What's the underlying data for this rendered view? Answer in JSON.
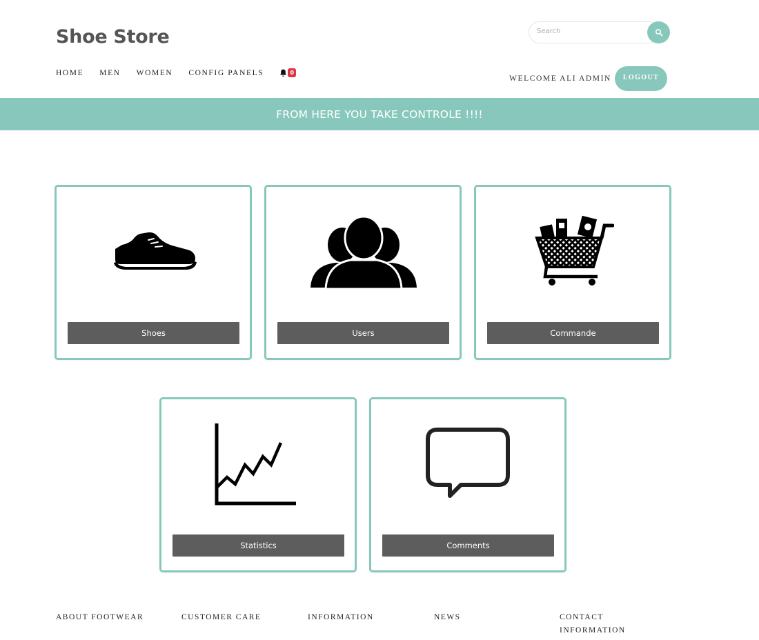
{
  "header": {
    "brand": "Shoe Store",
    "search": {
      "placeholder": "Search",
      "value": "",
      "icon": "search-icon"
    },
    "nav": [
      {
        "label": "HOME"
      },
      {
        "label": "MEN"
      },
      {
        "label": "WOMEN"
      },
      {
        "label": "CONFIG PANELS"
      }
    ],
    "notifications": {
      "icon": "bell-icon",
      "count": "0"
    },
    "welcome": "WELCOME ALI ADMIN",
    "logout": "LOGOUT"
  },
  "banner": {
    "text": "FROM HERE YOU TAKE CONTROLE !!!!"
  },
  "cards": [
    {
      "label": "Shoes",
      "icon": "shoe-icon"
    },
    {
      "label": "Users",
      "icon": "users-icon"
    },
    {
      "label": "Commande",
      "icon": "shopping-cart-icon"
    },
    {
      "label": "Statistics",
      "icon": "line-chart-icon"
    },
    {
      "label": "Comments",
      "icon": "speech-bubble-icon"
    }
  ],
  "footer": {
    "columns": [
      {
        "title": "ABOUT FOOTWEAR"
      },
      {
        "title": "CUSTOMER CARE"
      },
      {
        "title": "INFORMATION"
      },
      {
        "title": "NEWS"
      },
      {
        "title": "CONTACT INFORMATION"
      }
    ]
  },
  "colors": {
    "accent": "#88c8bc",
    "button": "#5d5d5d",
    "badge": "#dc3545",
    "brand_text": "#555555"
  }
}
